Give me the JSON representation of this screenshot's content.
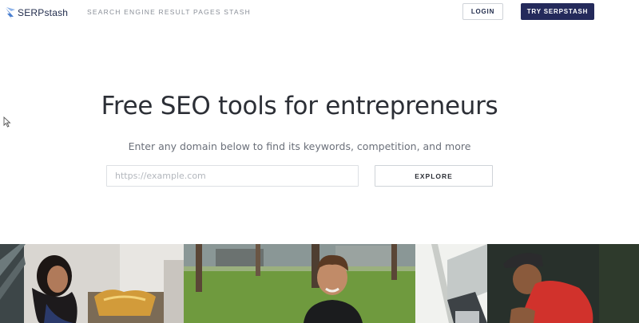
{
  "header": {
    "logo_text": "SERPstash",
    "tagline": "SEARCH ENGINE RESULT PAGES STASH",
    "login_label": "LOGIN",
    "try_label": "TRY SERPSTASH"
  },
  "hero": {
    "title": "Free SEO tools for entrepreneurs",
    "subtitle": "Enter any domain below to find its keywords, competition, and more",
    "search_placeholder": "https://example.com",
    "search_value": "",
    "explore_label": "EXPLORE"
  },
  "icons": [
    "logo-mark-icon",
    "mouse-cursor-icon"
  ],
  "colors": {
    "brand_navy": "#242a5b",
    "title_text": "#2c2f36",
    "muted_text": "#8a8f98",
    "border": "#cfd3d8"
  }
}
